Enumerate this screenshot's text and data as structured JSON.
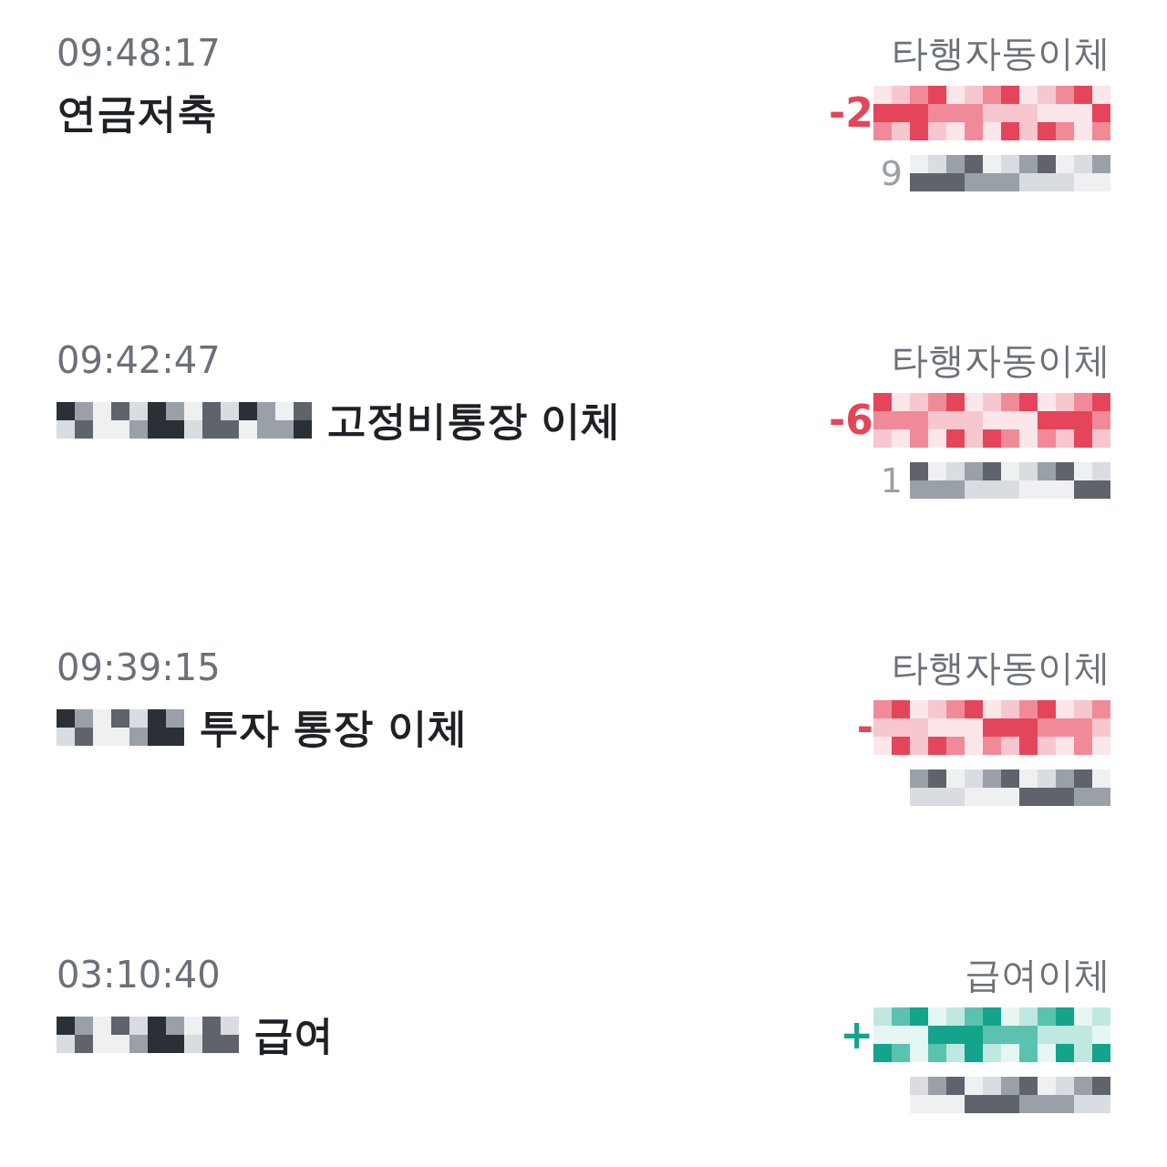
{
  "transactions": [
    {
      "time": "09:48:17",
      "title_redacted": false,
      "title": "연금저축",
      "type": "타행자동이체",
      "kind": "withdrawal",
      "amount_prefix": "-2",
      "balance_prefix": "9"
    },
    {
      "time": "09:42:47",
      "title_redacted": true,
      "title": "고정비통장 이체",
      "type": "타행자동이체",
      "kind": "withdrawal",
      "amount_prefix": "-6",
      "balance_prefix": "1"
    },
    {
      "time": "09:39:15",
      "title_redacted": true,
      "title": "투자 통장 이체",
      "type": "타행자동이체",
      "kind": "withdrawal",
      "amount_prefix": "-"
    },
    {
      "time": "03:10:40",
      "title_redacted": true,
      "title": "급여",
      "type": "급여이체",
      "kind": "deposit",
      "amount_prefix": "+"
    }
  ]
}
